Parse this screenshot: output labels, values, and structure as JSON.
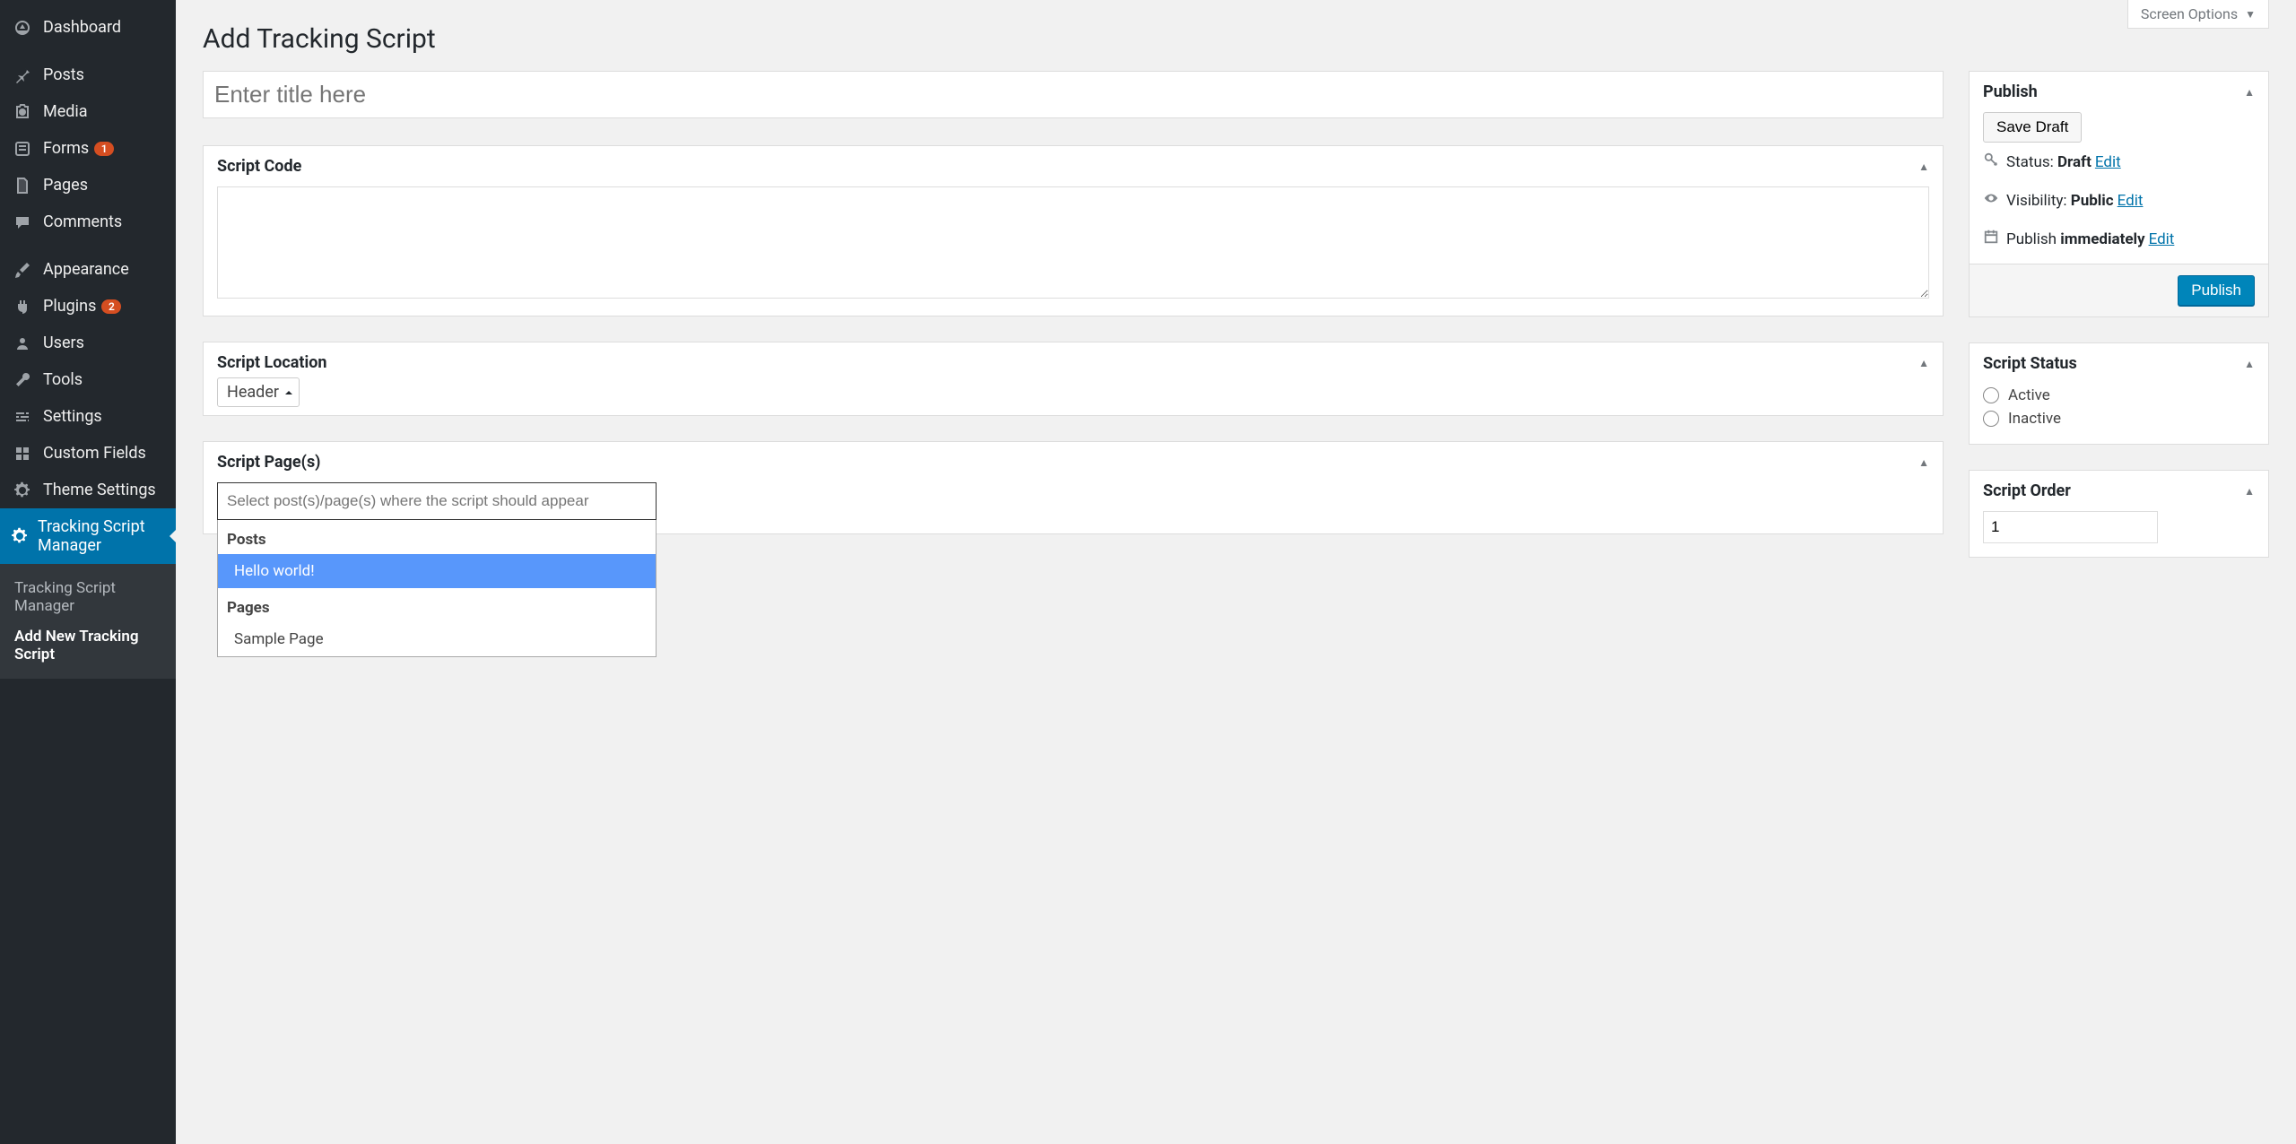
{
  "screen_options_label": "Screen Options",
  "page_title": "Add Tracking Script",
  "title_placeholder": "Enter title here",
  "sidebar": {
    "items": [
      {
        "icon": "dashboard",
        "label": "Dashboard"
      },
      {
        "icon": "pin",
        "label": "Posts"
      },
      {
        "icon": "media",
        "label": "Media"
      },
      {
        "icon": "forms",
        "label": "Forms",
        "badge": "1"
      },
      {
        "icon": "page",
        "label": "Pages"
      },
      {
        "icon": "comment",
        "label": "Comments"
      },
      {
        "icon": "brush",
        "label": "Appearance"
      },
      {
        "icon": "plug",
        "label": "Plugins",
        "badge": "2"
      },
      {
        "icon": "user",
        "label": "Users"
      },
      {
        "icon": "wrench",
        "label": "Tools"
      },
      {
        "icon": "sliders",
        "label": "Settings"
      },
      {
        "icon": "grid",
        "label": "Custom Fields"
      },
      {
        "icon": "gear",
        "label": "Theme Settings"
      },
      {
        "icon": "gear",
        "label": "Tracking Script Manager",
        "current": true
      }
    ],
    "submenu": [
      {
        "label": "Tracking Script Manager"
      },
      {
        "label": "Add New Tracking Script",
        "current": true
      }
    ]
  },
  "boxes": {
    "script_code": {
      "title": "Script Code",
      "value": ""
    },
    "script_location": {
      "title": "Script Location",
      "value": "Header"
    },
    "script_pages": {
      "title": "Script Page(s)",
      "placeholder": "Select post(s)/page(s) where the script should appear",
      "groups": [
        {
          "label": "Posts",
          "options": [
            {
              "label": "Hello world!",
              "highlight": true
            }
          ]
        },
        {
          "label": "Pages",
          "options": [
            {
              "label": "Sample Page"
            }
          ]
        }
      ]
    }
  },
  "publish": {
    "title": "Publish",
    "save_draft": "Save Draft",
    "status_label": "Status:",
    "status_value": "Draft",
    "visibility_label": "Visibility:",
    "visibility_value": "Public",
    "publish_label": "Publish",
    "publish_value": "immediately",
    "edit": "Edit",
    "publish_button": "Publish"
  },
  "script_status": {
    "title": "Script Status",
    "options": [
      "Active",
      "Inactive"
    ]
  },
  "script_order": {
    "title": "Script Order",
    "value": "1"
  }
}
